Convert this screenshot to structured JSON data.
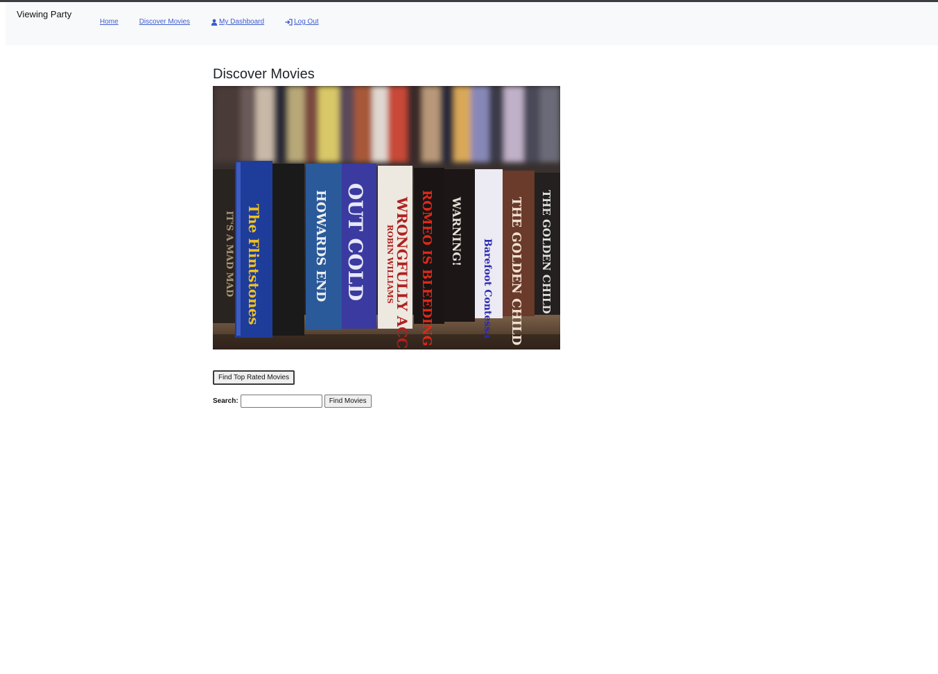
{
  "navbar": {
    "brand": "Viewing Party",
    "links": [
      {
        "label": "Home",
        "icon": null
      },
      {
        "label": "Discover Movies",
        "icon": null
      },
      {
        "label": "My Dashboard",
        "icon": "user-icon"
      },
      {
        "label": "Log Out",
        "icon": "sign-in-icon"
      }
    ],
    "link_color": "#3c5ccf"
  },
  "main": {
    "title": "Discover Movies",
    "image": {
      "description": "VHS tapes on a shelf",
      "spines": [
        "IT'S A MAD MAD",
        "The Flintstones",
        "",
        "HOWARDS END",
        "OUT COLD",
        "ROBIN WILLIAMS",
        "WRONGFULLY ACCUSED",
        "ROMEO IS BLEEDING",
        "WARNING!",
        "Barefoot Contessa",
        "THE GOLDEN CHILD"
      ]
    },
    "top_rated_button": "Find Top Rated Movies",
    "search": {
      "label": "Search:",
      "value": "",
      "placeholder": "",
      "button": "Find Movies"
    }
  }
}
